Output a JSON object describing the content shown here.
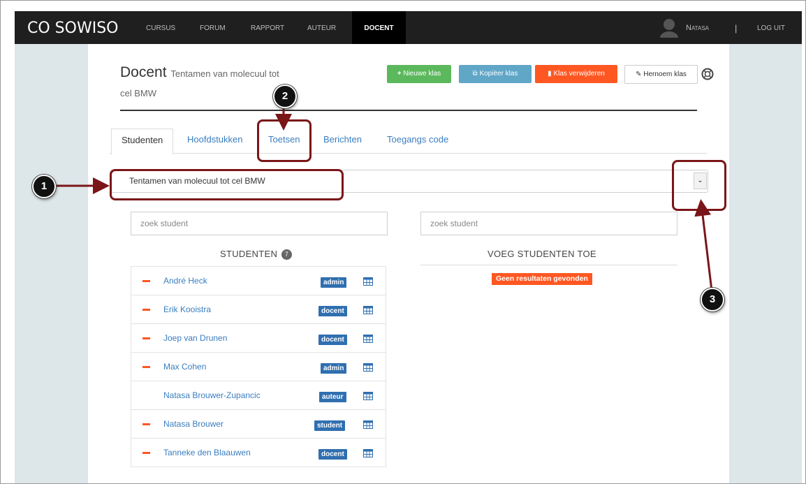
{
  "navbar": {
    "logo": "CO SOWISO",
    "items": [
      "CURSUS",
      "FORUM",
      "RAPPORT",
      "AUTEUR",
      "DOCENT"
    ],
    "active": "DOCENT",
    "user": "Natasa",
    "separator": "|",
    "logout": "LOG UIT"
  },
  "header": {
    "title": "Docent",
    "subtitle_line1": "Tentamen van molecuul tot",
    "subtitle_line2": "cel BMW"
  },
  "toolbar": {
    "new_class": "Nieuwe klas",
    "copy_class": "Kopiëer klas",
    "delete_class": "Klas verwijderen",
    "rename_class": "Hernoem klas"
  },
  "tabs": [
    "Studenten",
    "Hoofdstukken",
    "Toetsen",
    "Berichten",
    "Toegangs code"
  ],
  "class_select": {
    "value": "Tentamen van molecuul tot cel BMW"
  },
  "left_search": {
    "placeholder": "zoek student"
  },
  "right_search": {
    "placeholder": "zoek student"
  },
  "students_heading": "STUDENTEN",
  "students_count": "7",
  "add_heading": "VOEG STUDENTEN TOE",
  "no_results": "Geen resultaten gevonden",
  "students": [
    {
      "name": "André Heck",
      "role": "admin",
      "removable": true
    },
    {
      "name": "Erik Kooistra",
      "role": "docent",
      "removable": true
    },
    {
      "name": "Joep van Drunen",
      "role": "docent",
      "removable": true
    },
    {
      "name": "Max Cohen",
      "role": "admin",
      "removable": true
    },
    {
      "name": "Natasa Brouwer-Zupancic",
      "role": "auteur",
      "removable": false
    },
    {
      "name": "Natasa Brouwer",
      "role": "student",
      "removable": true
    },
    {
      "name": "Tanneke den Blaauwen",
      "role": "docent",
      "removable": true
    }
  ],
  "annotations": [
    "1",
    "2",
    "3"
  ],
  "colors": {
    "navbar": "#1f1f1f",
    "green": "#5cb85c",
    "blue": "#5fa6c7",
    "orange": "#ff5722",
    "role_badge": "#2f6fb0",
    "annotation_outline": "#7a1518"
  }
}
